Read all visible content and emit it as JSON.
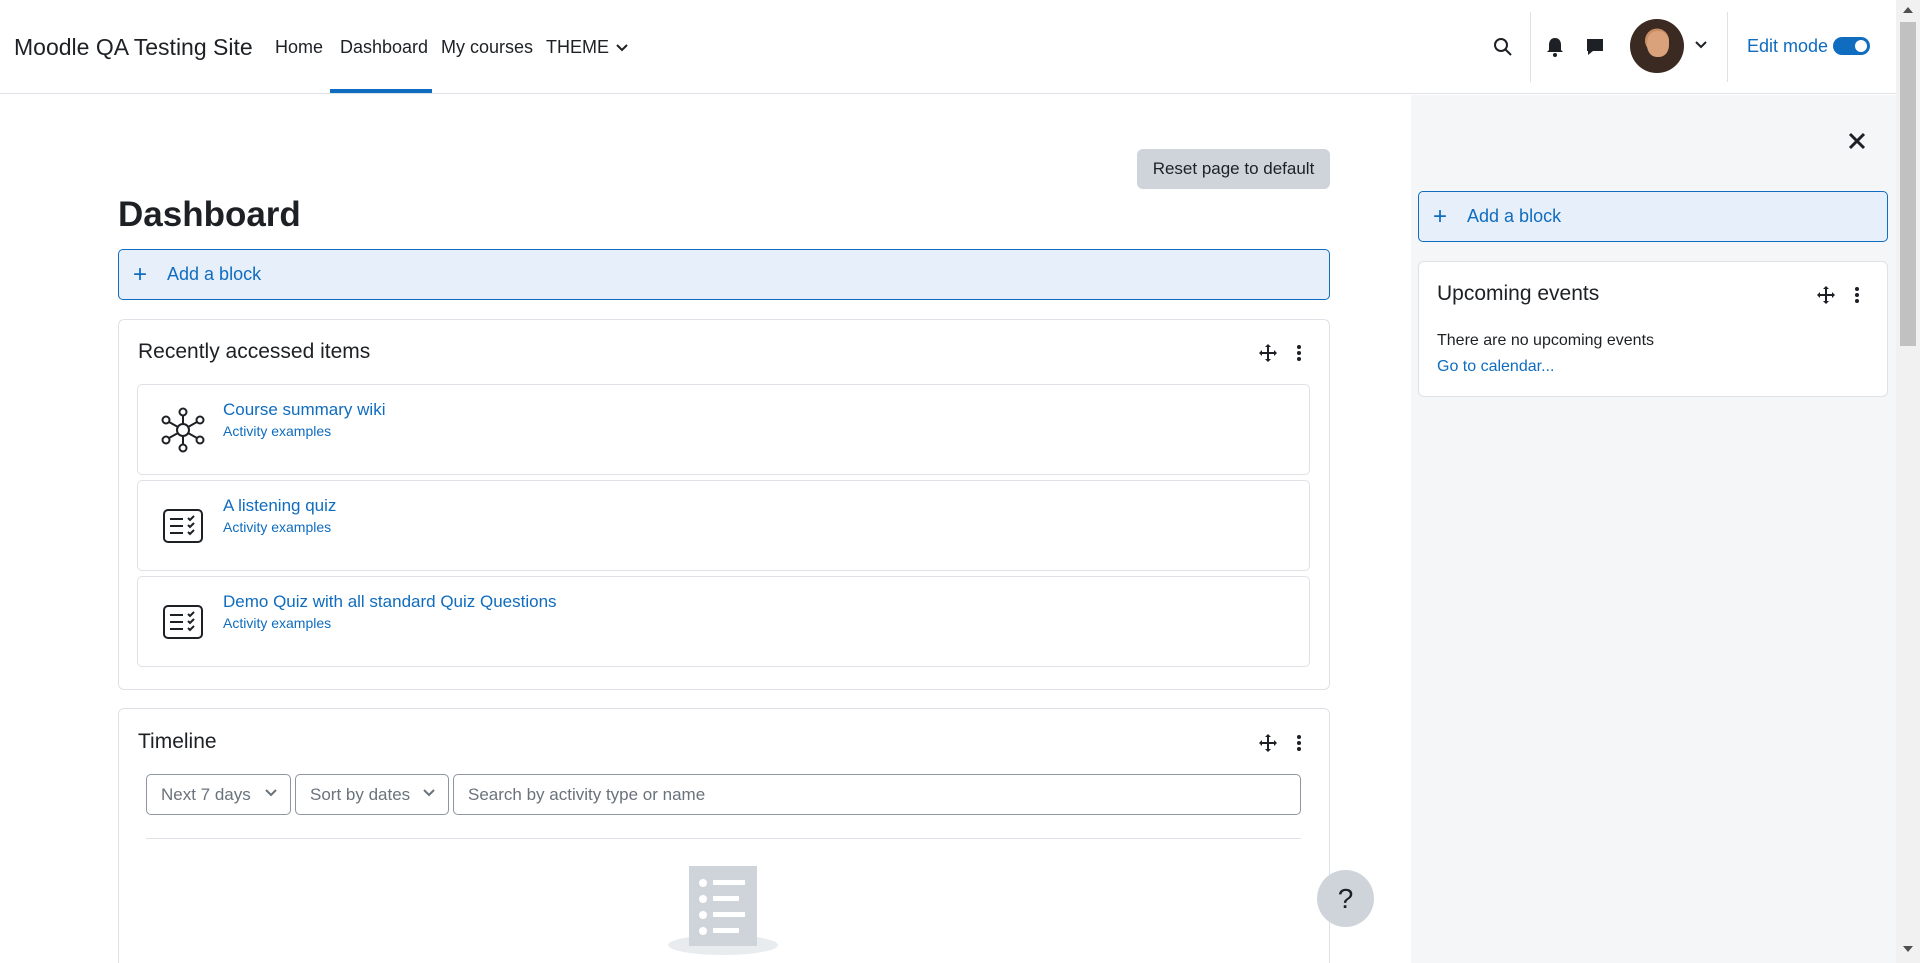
{
  "navbar": {
    "site_name": "Moodle QA Testing Site",
    "links": [
      "Home",
      "Dashboard",
      "My courses",
      "THEME"
    ],
    "edit_mode_label": "Edit mode",
    "edit_mode_on": true,
    "icons": [
      "search-icon",
      "bell-icon",
      "chat-icon",
      "chevron-down-icon"
    ]
  },
  "main": {
    "reset_label": "Reset page to default",
    "title": "Dashboard",
    "add_block_label": "Add a block",
    "recent": {
      "title": "Recently accessed items",
      "items": [
        {
          "name": "Course summary wiki",
          "course": "Activity examples",
          "icon": "wiki-icon"
        },
        {
          "name": "A listening quiz",
          "course": "Activity examples",
          "icon": "quiz-icon"
        },
        {
          "name": "Demo Quiz with all standard Quiz Questions",
          "course": "Activity examples",
          "icon": "quiz-icon"
        }
      ]
    },
    "timeline": {
      "title": "Timeline",
      "filter_label": "Next 7 days",
      "sort_label": "Sort by dates",
      "search_placeholder": "Search by activity type or name"
    },
    "help_label": "?"
  },
  "drawer": {
    "add_block_label": "Add a block",
    "upcoming": {
      "title": "Upcoming events",
      "empty_text": "There are no upcoming events",
      "calendar_link": "Go to calendar..."
    }
  },
  "colors": {
    "accent": "#0f6cbf",
    "drawer_bg": "#f5f6f7",
    "add_block_bg": "#e7f0fa"
  }
}
